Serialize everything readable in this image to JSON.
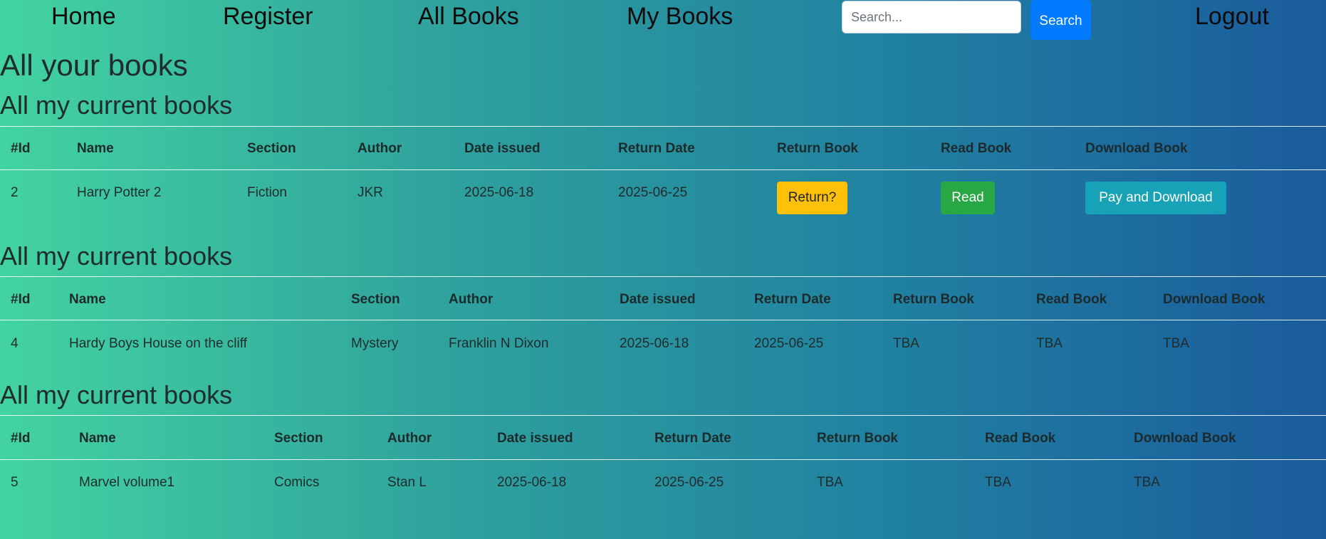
{
  "nav": {
    "home": "Home",
    "register": "Register",
    "all_books": "All Books",
    "my_books": "My Books",
    "search_placeholder": "Search...",
    "search_button": "Search",
    "logout": "Logout"
  },
  "page_title": "All your books",
  "headers": {
    "id": "#Id",
    "name": "Name",
    "section": "Section",
    "author": "Author",
    "date_issued": "Date issued",
    "return_date": "Return Date",
    "return_book": "Return Book",
    "read_book": "Read Book",
    "download_book": "Download Book"
  },
  "tables": [
    {
      "title": "All my current books",
      "row": {
        "id": "2",
        "name": "Harry Potter 2",
        "section": "Fiction",
        "author": "JKR",
        "date_issued": "2025-06-18",
        "return_date": "2025-06-25",
        "return_action": "Return?",
        "read_action": "Read",
        "download_action": "Pay and Download"
      }
    },
    {
      "title": "All my current books",
      "row": {
        "id": "4",
        "name": "Hardy Boys House on the cliff",
        "section": "Mystery",
        "author": "Franklin N Dixon",
        "date_issued": "2025-06-18",
        "return_date": "2025-06-25",
        "return_action": "TBA",
        "read_action": "TBA",
        "download_action": "TBA"
      }
    },
    {
      "title": "All my current books",
      "row": {
        "id": "5",
        "name": "Marvel volume1",
        "section": "Comics",
        "author": "Stan L",
        "date_issued": "2025-06-18",
        "return_date": "2025-06-25",
        "return_action": "TBA",
        "read_action": "TBA",
        "download_action": "TBA"
      }
    }
  ],
  "colors": {
    "gradient_start": "#43d3a1",
    "gradient_end": "#1a5b9c",
    "search_button": "#007bff",
    "return_button": "#ffc107",
    "read_button": "#28a745",
    "download_button": "#17a2b8"
  }
}
